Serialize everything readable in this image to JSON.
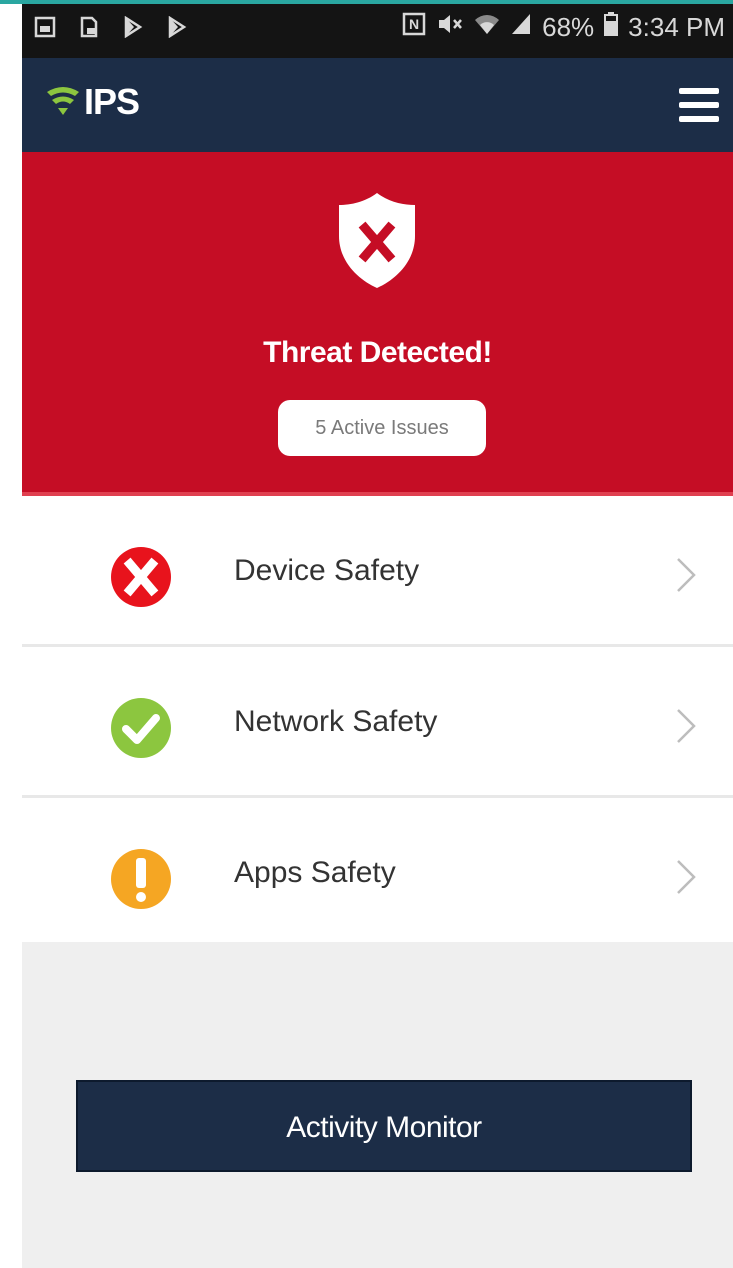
{
  "status_bar": {
    "left_icons": [
      "image-icon",
      "document-icon",
      "play-store-icon",
      "play-store-icon"
    ],
    "right_icons": [
      "nfc-icon",
      "mute-icon",
      "wifi-icon",
      "signal-icon"
    ],
    "battery": "68%",
    "time": "3:34 PM"
  },
  "app_bar": {
    "logo_text": "IPS",
    "logo_color": "#8cc63f",
    "background": "#1c2d47"
  },
  "banner": {
    "title": "Threat Detected!",
    "issues_label": "5 Active Issues",
    "background": "#c50d25"
  },
  "safety_items": [
    {
      "label": "Device Safety",
      "status": "danger",
      "icon": "x-circle-icon",
      "color": "#e8131c"
    },
    {
      "label": "Network Safety",
      "status": "ok",
      "icon": "check-circle-icon",
      "color": "#8cc63f"
    },
    {
      "label": "Apps Safety",
      "status": "warning",
      "icon": "exclamation-circle-icon",
      "color": "#f5a623"
    }
  ],
  "activity_button": {
    "label": "Activity Monitor"
  }
}
